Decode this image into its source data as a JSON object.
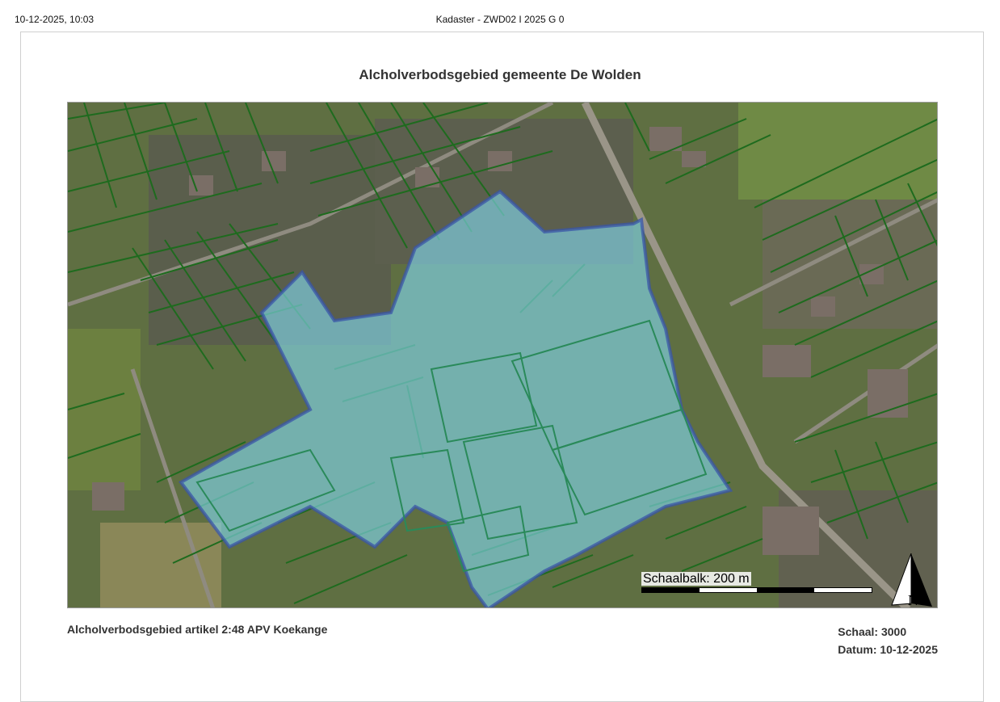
{
  "header": {
    "datetime": "10-12-2025, 10:03",
    "doc_ref": "Kadaster - ZWD02 I 2025 G 0"
  },
  "map": {
    "title": "Alcholverbodsgebied gemeente De Wolden",
    "scalebar_label": "Schaalbalk: 200 m",
    "north_label": "N",
    "icon": "north-arrow-icon",
    "colors": {
      "parcel_lines": "#1e6b1e",
      "highlight_fill": "#7fd3e6",
      "highlight_stroke": "#3a56a8",
      "aerial_base": "#5d6f3e"
    }
  },
  "footer": {
    "caption": "Alcholverbodsgebied artikel 2:48 APV Koekange",
    "scale": "Schaal: 3000",
    "date": "Datum: 10-12-2025"
  }
}
